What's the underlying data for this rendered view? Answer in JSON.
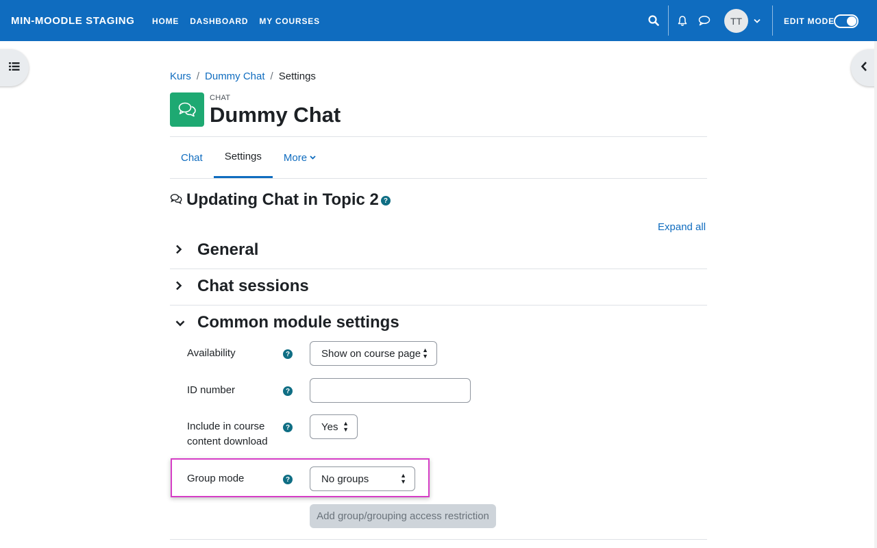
{
  "navbar": {
    "brand": "MIN-MOODLE STAGING",
    "links": [
      "HOME",
      "DASHBOARD",
      "MY COURSES"
    ],
    "avatar_initials": "TT",
    "edit_mode_label": "EDIT MODE",
    "edit_mode_on": true,
    "icons": [
      "search-icon",
      "bell-icon",
      "chat-bubble-icon",
      "chevron-down-icon"
    ],
    "background_color": "#0f6cbf"
  },
  "breadcrumb": {
    "items": [
      "Kurs",
      "Dummy Chat",
      "Settings"
    ],
    "separator": "/"
  },
  "header": {
    "activity_type": "CHAT",
    "title": "Dummy Chat",
    "icon_color": "#1ea972"
  },
  "tabs": [
    {
      "label": "Chat",
      "active": false
    },
    {
      "label": "Settings",
      "active": true
    },
    {
      "label": "More",
      "active": false
    }
  ],
  "form": {
    "heading": "Updating Chat in Topic 2",
    "expand_all": "Expand all",
    "sections": [
      {
        "label": "General",
        "expanded": false
      },
      {
        "label": "Chat sessions",
        "expanded": false
      },
      {
        "label": "Common module settings",
        "expanded": true
      }
    ],
    "fields": {
      "availability": {
        "label": "Availability",
        "value": "Show on course page"
      },
      "id_number": {
        "label": "ID number",
        "value": ""
      },
      "download": {
        "label_line1": "Include in course",
        "label_line2": "content download",
        "value": "Yes"
      },
      "group_mode": {
        "label": "Group mode",
        "value": "No groups"
      }
    },
    "restriction_button": "Add group/grouping access restriction"
  },
  "highlight_color": "#d63ec6"
}
